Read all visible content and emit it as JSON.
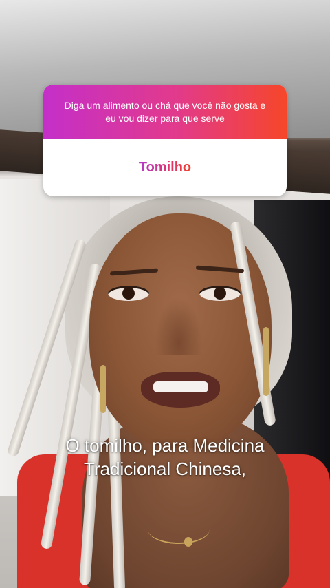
{
  "question_sticker": {
    "prompt": "Diga um alimento ou chá que você não gosta e eu vou dizer para que serve",
    "answer": "Tomilho",
    "colors": {
      "gradient_start": "#c42fc9",
      "gradient_mid": "#e23a8b",
      "gradient_end": "#f6462a",
      "answer_bg": "#ffffff"
    }
  },
  "caption": {
    "line1": "O tomilho, para Medicina",
    "line2": "Tradicional Chinesa,"
  }
}
